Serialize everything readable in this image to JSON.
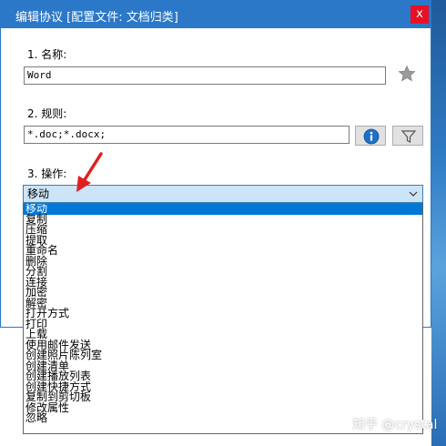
{
  "window": {
    "title": "编辑协议 [配置文件: 文档归类]",
    "close_glyph": "x"
  },
  "name_section": {
    "label": "1. 名称:",
    "value": "Word"
  },
  "rule_section": {
    "label": "2. 规则:",
    "value": "*.doc;*.docx;"
  },
  "action_section": {
    "label": "3. 操作:",
    "selected": "移动",
    "options": [
      "移动",
      "复制",
      "压缩",
      "提取",
      "重命名",
      "删除",
      "分割",
      "连接",
      "加密",
      "解密",
      "打开方式",
      "打印",
      "上载",
      "使用邮件发送",
      "创建照片陈列室",
      "创建清单",
      "创建播放列表",
      "创建快捷方式",
      "复制到剪切板",
      "修改属性",
      "忽略"
    ]
  },
  "watermark": "知乎 @crystal",
  "colors": {
    "titlebar": "#2b78c8",
    "selection": "#0078d7",
    "arrow": "#e02020"
  }
}
